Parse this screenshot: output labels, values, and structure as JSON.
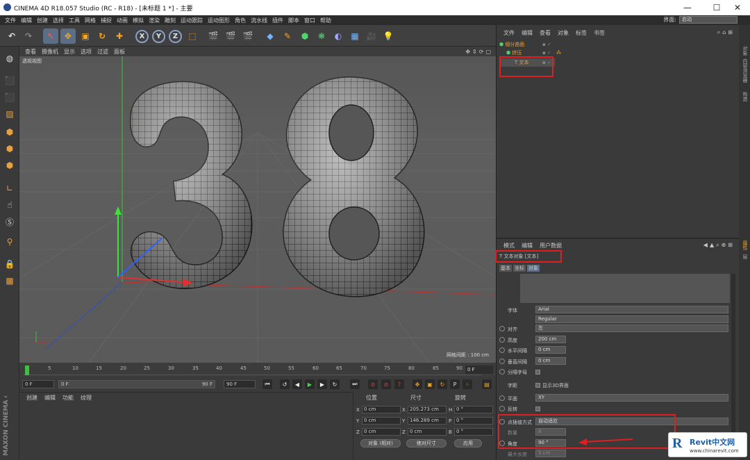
{
  "window": {
    "title": "CINEMA 4D R18.057 Studio (RC - R18) - [未标题 1 *] - 主要"
  },
  "menubar": {
    "items": [
      "文件",
      "编辑",
      "创建",
      "选择",
      "工具",
      "网格",
      "捕捉",
      "动画",
      "模拟",
      "渲染",
      "雕刻",
      "运动跟踪",
      "运动图形",
      "角色",
      "流水线",
      "插件",
      "脚本",
      "窗口",
      "帮助"
    ],
    "layout_label": "界面:",
    "layout_value": "启动"
  },
  "viewport": {
    "menu": [
      "查看",
      "摄像机",
      "显示",
      "选项",
      "过滤",
      "面板"
    ],
    "camera_label": "透视视图",
    "grid_label": "网格间距 : 100 cm"
  },
  "timeline": {
    "ticks": [
      "0",
      "5",
      "10",
      "15",
      "20",
      "25",
      "30",
      "35",
      "40",
      "45",
      "50",
      "55",
      "60",
      "65",
      "70",
      "75",
      "80",
      "85",
      "90"
    ],
    "current_frame": "0 F"
  },
  "transport": {
    "start": "0 F",
    "range_start": "0 F",
    "range_end": "90 F",
    "end": "90 F"
  },
  "materials": {
    "menu": [
      "创建",
      "编辑",
      "功能",
      "纹理"
    ],
    "logo": "MAXON CINEMA 4D"
  },
  "coordinates": {
    "headers": [
      "位置",
      "尺寸",
      "旋转"
    ],
    "rows": [
      {
        "axis": "X",
        "pos": "0 cm",
        "size_axis": "X",
        "size": "205.273 cm",
        "rot_axis": "H",
        "rot": "0 °"
      },
      {
        "axis": "Y",
        "pos": "0 cm",
        "size_axis": "Y",
        "size": "146.289 cm",
        "rot_axis": "P",
        "rot": "0 °"
      },
      {
        "axis": "Z",
        "pos": "0 cm",
        "size_axis": "Z",
        "size": "0 cm",
        "rot_axis": "B",
        "rot": "0 °"
      }
    ],
    "mode": "对象 (相对)",
    "size_mode": "绝对尺寸",
    "apply": "应用"
  },
  "object_manager": {
    "menu": [
      "文件",
      "编辑",
      "查看",
      "对象",
      "标签",
      "书签"
    ],
    "objects": [
      {
        "name": "细分曲面",
        "indent": 0
      },
      {
        "name": "挤压",
        "indent": 1
      },
      {
        "name": "文本",
        "indent": 2
      }
    ]
  },
  "attributes": {
    "menu": [
      "模式",
      "编辑",
      "用户数据"
    ],
    "object_title": "文本对象 [文本]",
    "tabs": [
      "基本",
      "坐标",
      "对象"
    ],
    "active_tab": "对象",
    "fields": {
      "font_label": "字体",
      "font": "Arial",
      "style": "Regular",
      "align_label": "对齐",
      "align": "左",
      "height_label": "高度",
      "height": "200 cm",
      "hspace_label": "水平间隔",
      "hspace": "0 cm",
      "vspace_label": "垂直间隔",
      "vspace": "0 cm",
      "separate_label": "分隔字母",
      "kerning_label": "字距",
      "kerning_check": "显示3D界面",
      "plane_label": "平面",
      "plane": "XY",
      "reverse_label": "反转",
      "interp_label": "点插值方式",
      "interp": "自动适应",
      "count_label": "数量",
      "count": "8",
      "angle_label": "角度",
      "angle": "90 °",
      "maxlen_label": "最大长度",
      "maxlen": "5 cm"
    }
  },
  "side_tabs": [
    "对象",
    "内容浏览器",
    "构造",
    "属性",
    "层"
  ],
  "watermark": {
    "brand": "Revit中文网",
    "url": "www.chinarevit.com"
  },
  "colors": {
    "accent": "#f5a623",
    "highlight": "#e02020",
    "panel": "#3a3a3a"
  }
}
